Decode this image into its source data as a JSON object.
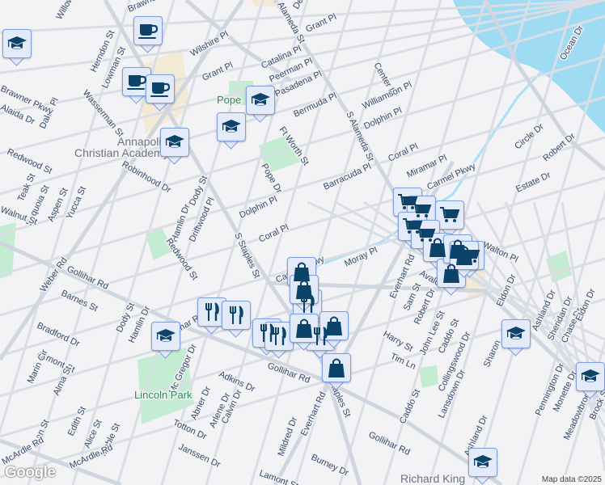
{
  "map": {
    "colors": {
      "water": "#9fdcf4",
      "park": "#c4ecd2",
      "commercial": "#f3ead6",
      "road": "#d6dde5",
      "marker_fill": "#e3ebfb",
      "marker_border": "#7d9ee0",
      "icon": "#0b4468"
    },
    "streets": [
      "Willow St",
      "Brawner Pkwy",
      "Herndon St",
      "Lowman St",
      "Wasserman St",
      "Dakin Pl",
      "Brawner Pkwy",
      "Alaida Dr",
      "Redwood St",
      "Robinhood Dr",
      "Teak St",
      "Sequoia St",
      "Aspen St",
      "Yucca St",
      "Walnut St",
      "Wilshire Pl",
      "Grant Pl",
      "Catalina Pl",
      "Peerman Pl",
      "Pasadena Pl",
      "Grant Pl",
      "Delaine",
      "Alameda St",
      "Bermuda Pl",
      "Ft Worth St",
      "Dody St",
      "Hamlin Dr",
      "Driftwood Pl",
      "Redwood St",
      "Pope Dr",
      "Dolphin Pl",
      "Coral Pl",
      "S Staples St",
      "Center Dr",
      "Williamson Pl",
      "Dolphin Pl",
      "S Alameda St",
      "Barracuda Pl",
      "Coral Pl",
      "Miramar Pl",
      "Carmel Pkwy",
      "Carmel Pkwy",
      "Moray Pl",
      "Everhart Rd",
      "Walton Pl",
      "Avalon St",
      "Sam St",
      "Robert Dr",
      "John Lee St",
      "Caddo St",
      "Harry St",
      "Tim Ln",
      "Collingswood Dr",
      "Eldon Dr",
      "Ashland Dr",
      "Sheridan Dr",
      "Chase Dr",
      "Sharon",
      "Pennington Dr",
      "Monette Dr",
      "Meadowbrook Dr",
      "Brock St",
      "Lansdown Dr",
      "Caddo St",
      "Ashland Dr",
      "Gollihar Rd",
      "Burney Dr",
      "Everhart Rd",
      "S Staples St",
      "Mildred Dr",
      "Lamont St",
      "Janssen Dr",
      "Totton Dr",
      "Calvin Dr",
      "Arlene Dr",
      "Abner Dr",
      "Mc Gregor Dr",
      "Adkins Dr",
      "Gollihar Rd",
      "Gollihar Rd",
      "Gollihar Rd",
      "Weber Rd",
      "Barnes St",
      "Dody St",
      "Hamlin Dr",
      "Bradford Dr",
      "Lamont St",
      "Marin Cir",
      "Alma St",
      "Edith St",
      "Alice St",
      "Mable St",
      "Jean St",
      "McArdle Rd",
      "McArdle Rd",
      "Circle Dr",
      "Robert Dr",
      "Estate Dr",
      "Ocean Dr",
      "Eldon Dr"
    ],
    "parks": [
      "Pope",
      "Lincoln Park"
    ],
    "pois": [
      "Annapolis",
      "Christian Academy",
      "Richard King"
    ],
    "markers": [
      "school",
      "coffee",
      "coffee",
      "coffee",
      "school",
      "school",
      "school",
      "school",
      "school",
      "school",
      "school",
      "shopping-cart",
      "shopping-cart",
      "shopping-cart",
      "shopping-cart",
      "shopping-cart",
      "shopping-cart",
      "shopping-bag",
      "shopping-bag",
      "shopping-bag",
      "shopping-bag",
      "restaurant",
      "restaurant",
      "restaurant",
      "restaurant",
      "restaurant",
      "restaurant",
      "shopping-bag",
      "shopping-bag",
      "shopping-bag",
      "shopping-bag",
      "shopping-bag"
    ],
    "attribution": "Map data ©2025",
    "logo": "Google"
  }
}
